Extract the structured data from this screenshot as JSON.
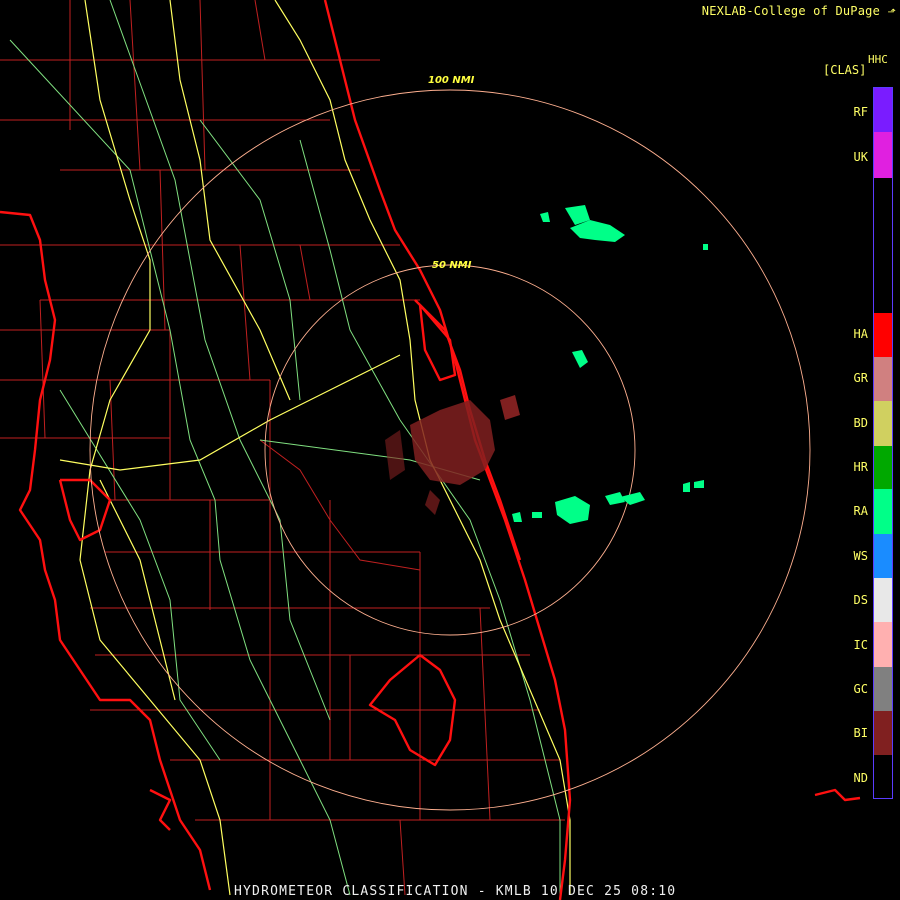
{
  "header": {
    "credit": "NEXLAB-College of DuPage"
  },
  "footer": {
    "title": "HYDROMETEOR CLASSIFICATION - KMLB 10 DEC 25 08:10"
  },
  "range_rings": [
    {
      "label": "100 NMI"
    },
    {
      "label": "50 NMI"
    }
  ],
  "legend": {
    "product": "HHC",
    "units": "[CLAS]",
    "classes": [
      {
        "code": "RF",
        "color": "#7a1cff"
      },
      {
        "code": "UK",
        "color": "#e020e0"
      },
      {
        "code": "HA",
        "color": "#ff0000"
      },
      {
        "code": "GR",
        "color": "#d08080"
      },
      {
        "code": "BD",
        "color": "#d0d060"
      },
      {
        "code": "HR",
        "color": "#00a800"
      },
      {
        "code": "RA",
        "color": "#00ff88"
      },
      {
        "code": "WS",
        "color": "#1a8cff"
      },
      {
        "code": "DS",
        "color": "#e8e8e8"
      },
      {
        "code": "IC",
        "color": "#ffb0b0"
      },
      {
        "code": "GC",
        "color": "#808080"
      },
      {
        "code": "BI",
        "color": "#802020"
      },
      {
        "code": "ND",
        "color": "#000000"
      }
    ]
  },
  "colors": {
    "coast": "#ff1010",
    "county": "#c02020",
    "highway_major": "#ffff60",
    "highway_minor": "#80e080",
    "ring": "#ffb090",
    "ring_label": "#ffff40"
  }
}
